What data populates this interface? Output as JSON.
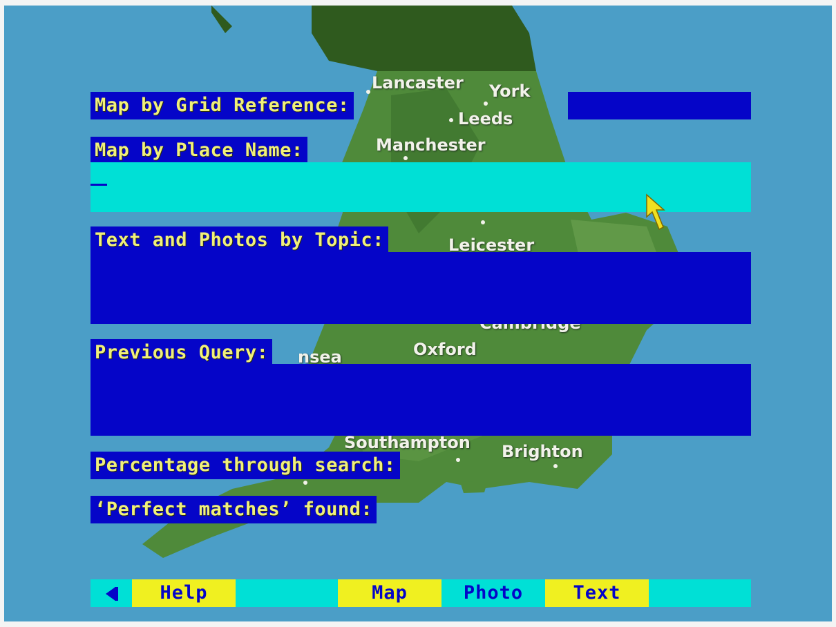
{
  "colors": {
    "panel_blue": "#0505c8",
    "label_yellow": "#f0f07a",
    "input_cyan": "#00e0d6",
    "button_yellow": "#f0f020",
    "sea": "#4b9ec7",
    "land": "#4f8a3a"
  },
  "map": {
    "towns": [
      "Lancaster",
      "York",
      "Leeds",
      "Manchester",
      "Leicester",
      "Cambridge",
      "Oxford",
      "nsea",
      "Southampton",
      "Brighton"
    ]
  },
  "form": {
    "grid_ref_label": "Map by Grid Reference:",
    "grid_ref_value": "",
    "place_name_label": "Map by Place Name:",
    "place_name_value": "",
    "topic_label": "Text and Photos by Topic:",
    "topic_value": "",
    "previous_query_label": "Previous Query:",
    "previous_query_value": "",
    "percentage_label": "Percentage through search:",
    "perfect_matches_label": "‘Perfect matches’ found:"
  },
  "toolbar": {
    "back_icon": "left-triangle-icon",
    "help_label": "Help",
    "map_label": "Map",
    "photo_label": "Photo",
    "text_label": "Text"
  },
  "pointer_icon": "arrow-pointer-icon"
}
